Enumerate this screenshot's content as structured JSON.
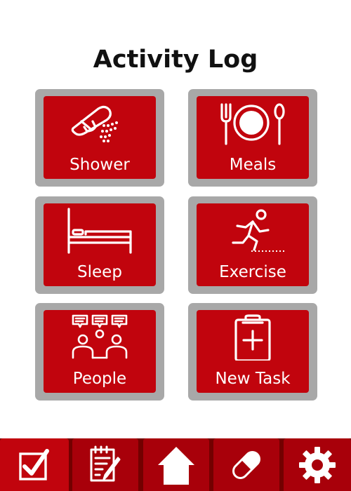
{
  "header": {
    "title": "Activity Log"
  },
  "tiles": [
    {
      "label": "Shower",
      "icon": "shower-icon"
    },
    {
      "label": "Meals",
      "icon": "meals-icon"
    },
    {
      "label": "Sleep",
      "icon": "bed-icon"
    },
    {
      "label": "Exercise",
      "icon": "running-icon"
    },
    {
      "label": "People",
      "icon": "people-chat-icon"
    },
    {
      "label": "New Task",
      "icon": "clipboard-add-icon"
    }
  ],
  "bottom_nav": {
    "items": [
      {
        "icon": "checkbox-icon",
        "active": true
      },
      {
        "icon": "notes-edit-icon",
        "active": false
      },
      {
        "icon": "home-icon",
        "active": false
      },
      {
        "icon": "pill-icon",
        "active": false
      },
      {
        "icon": "gear-icon",
        "active": false
      }
    ]
  },
  "colors": {
    "tile_red": "#c1040d",
    "tile_border": "#a8a8a8",
    "nav_dark": "#730000",
    "nav_button": "#a8000a"
  }
}
